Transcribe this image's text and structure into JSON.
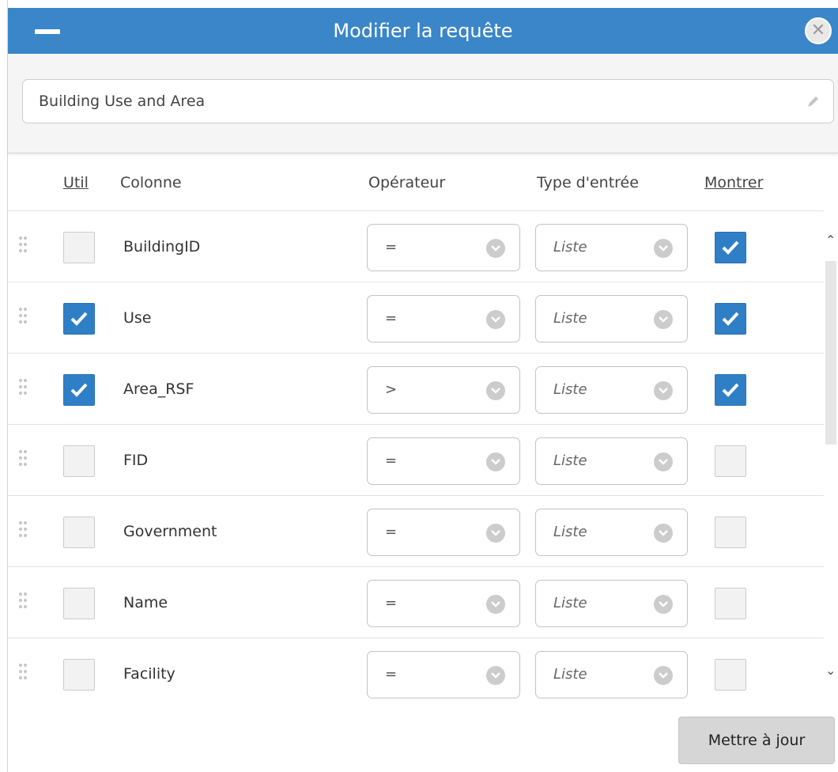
{
  "dialog": {
    "title": "Modifier la requête"
  },
  "query": {
    "name": "Building Use and Area"
  },
  "columns_header": {
    "use": "Util",
    "column": "Colonne",
    "operator": "Opérateur",
    "input_type": "Type d'entrée",
    "show": "Montrer"
  },
  "rows": [
    {
      "name": "BuildingID",
      "use": false,
      "operator": "=",
      "input_type": "Liste",
      "show": true
    },
    {
      "name": "Use",
      "use": true,
      "operator": "=",
      "input_type": "Liste",
      "show": true
    },
    {
      "name": "Area_RSF",
      "use": true,
      "operator": ">",
      "input_type": "Liste",
      "show": true
    },
    {
      "name": "FID",
      "use": false,
      "operator": "=",
      "input_type": "Liste",
      "show": false
    },
    {
      "name": "Government",
      "use": false,
      "operator": "=",
      "input_type": "Liste",
      "show": false
    },
    {
      "name": "Name",
      "use": false,
      "operator": "=",
      "input_type": "Liste",
      "show": false
    },
    {
      "name": "Facility",
      "use": false,
      "operator": "=",
      "input_type": "Liste",
      "show": false
    }
  ],
  "footer": {
    "update_label": "Mettre à jour"
  },
  "colors": {
    "titlebar": "#3a86c8",
    "checkbox_checked": "#2f7fc6"
  }
}
